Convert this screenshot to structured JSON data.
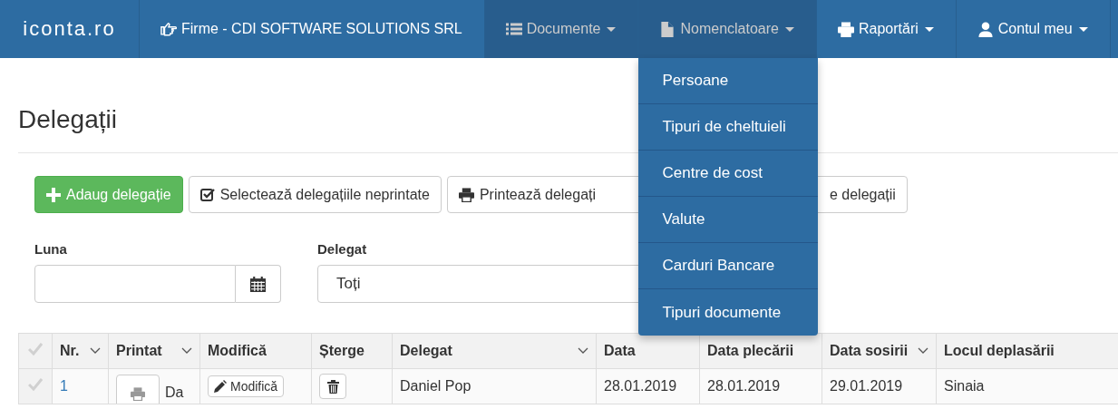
{
  "navbar": {
    "brand": "iconta.ro",
    "items": [
      {
        "label": "Firme - CDI SOFTWARE SOLUTIONS SRL",
        "dropdown": false,
        "highlighted": false
      },
      {
        "label": "Documente",
        "dropdown": true,
        "highlighted": true
      },
      {
        "label": "Nomenclatoare",
        "dropdown": true,
        "highlighted": true,
        "open": true,
        "menu": [
          "Persoane",
          "Tipuri de cheltuieli",
          "Centre de cost",
          "Valute",
          "Carduri Bancare",
          "Tipuri documente"
        ]
      },
      {
        "label": "Raportări",
        "dropdown": true,
        "highlighted": false
      },
      {
        "label": "Contul meu",
        "dropdown": true,
        "highlighted": false
      }
    ]
  },
  "page_title": "Delegații",
  "toolbar": [
    {
      "label": "Adaug delegație",
      "kind": "primary"
    },
    {
      "label": "Selectează delegațiile neprintate",
      "kind": "default"
    },
    {
      "label": "Printează delegați",
      "kind": "default"
    },
    {
      "label": "e delegații",
      "kind": "default"
    }
  ],
  "filters": {
    "month": {
      "label": "Luna"
    },
    "delegate": {
      "label": "Delegat",
      "value": "Toți"
    }
  },
  "table": {
    "all_selected": false,
    "columns": [
      {
        "label": "Nr.",
        "sortable": true
      },
      {
        "label": "Printat",
        "sortable": true
      },
      {
        "label": "Modifică",
        "sortable": false
      },
      {
        "label": "Șterge",
        "sortable": false
      },
      {
        "label": "Delegat",
        "sortable": true
      },
      {
        "label": "Data",
        "sortable": false
      },
      {
        "label": "Data plecării",
        "sortable": false
      },
      {
        "label": "Data sosirii",
        "sortable": true
      },
      {
        "label": "Locul deplasării",
        "sortable": false
      }
    ],
    "rows": [
      {
        "selected": false,
        "nr": "1",
        "printed": "Da",
        "edit": "Modifică",
        "delegate": "Daniel Pop",
        "date": "28.01.2019",
        "departure": "28.01.2019",
        "arrival": "29.01.2019",
        "place": "Sinaia"
      }
    ]
  }
}
